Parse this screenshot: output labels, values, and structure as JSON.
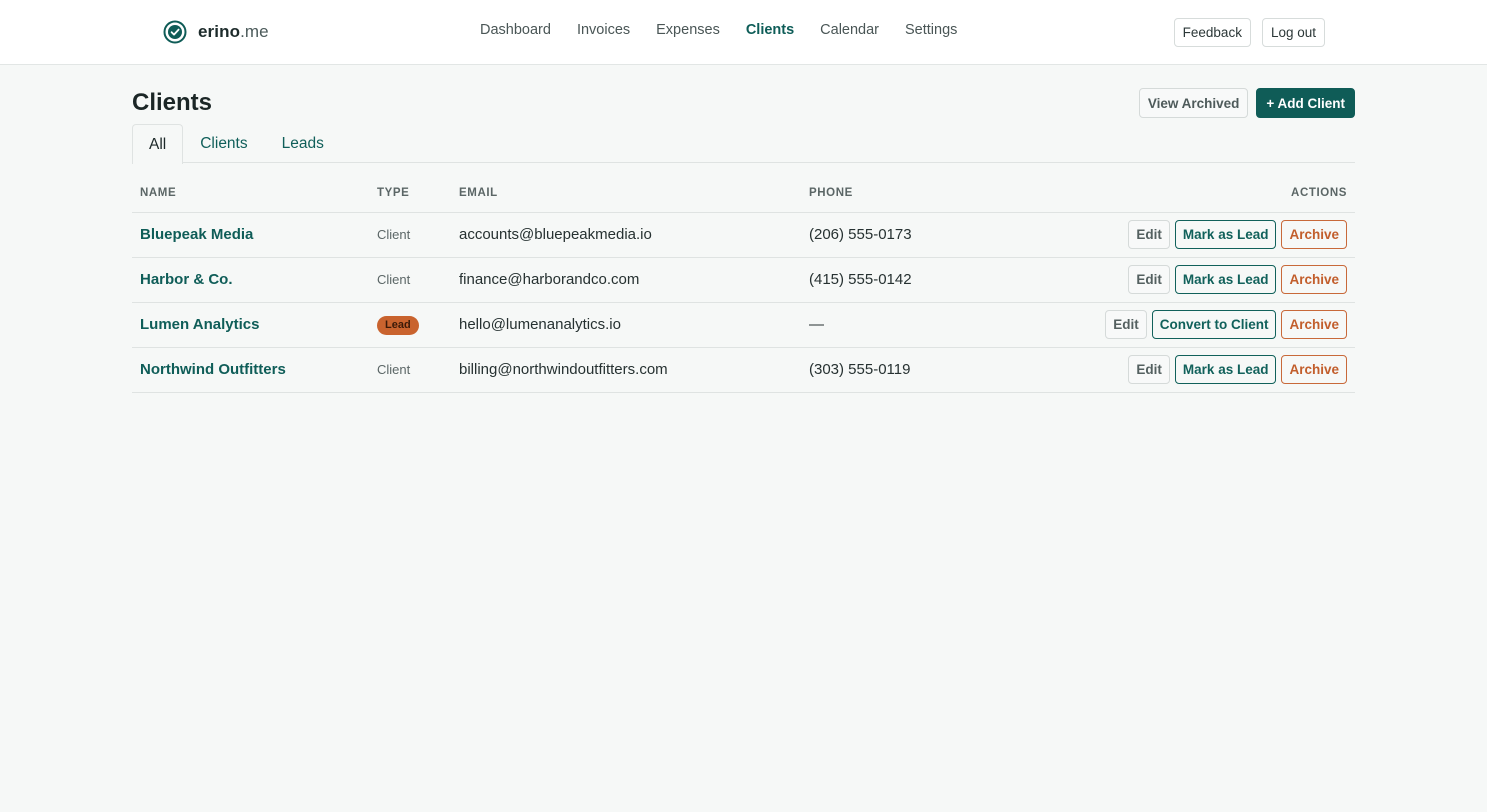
{
  "brand": {
    "name_main": "erino",
    "name_suffix": ".me",
    "logo_icon": "check-circle-icon"
  },
  "nav": {
    "items": [
      {
        "label": "Dashboard",
        "active": false
      },
      {
        "label": "Invoices",
        "active": false
      },
      {
        "label": "Expenses",
        "active": false
      },
      {
        "label": "Clients",
        "active": true
      },
      {
        "label": "Calendar",
        "active": false
      },
      {
        "label": "Settings",
        "active": false
      }
    ],
    "feedback_label": "Feedback",
    "logout_label": "Log out"
  },
  "page": {
    "title": "Clients",
    "view_archived_label": "View Archived",
    "add_client_label": "+ Add Client"
  },
  "tabs": [
    {
      "label": "All",
      "active": true
    },
    {
      "label": "Clients",
      "active": false
    },
    {
      "label": "Leads",
      "active": false
    }
  ],
  "table": {
    "headers": {
      "name": "NAME",
      "type": "TYPE",
      "email": "EMAIL",
      "phone": "PHONE",
      "actions": "ACTIONS"
    },
    "rows": [
      {
        "name": "Bluepeak Media",
        "type": "Client",
        "email": "accounts@bluepeakmedia.io",
        "phone": "(206) 555-0173",
        "edit": "Edit",
        "convert": "Mark as Lead",
        "archive": "Archive"
      },
      {
        "name": "Harbor & Co.",
        "type": "Client",
        "email": "finance@harborandco.com",
        "phone": "(415) 555-0142",
        "edit": "Edit",
        "convert": "Mark as Lead",
        "archive": "Archive"
      },
      {
        "name": "Lumen Analytics",
        "type": "Lead",
        "email": "hello@lumenanalytics.io",
        "phone": "—",
        "edit": "Edit",
        "convert": "Convert to Client",
        "archive": "Archive"
      },
      {
        "name": "Northwind Outfitters",
        "type": "Client",
        "email": "billing@northwindoutfitters.com",
        "phone": "(303) 555-0119",
        "edit": "Edit",
        "convert": "Mark as Lead",
        "archive": "Archive"
      }
    ]
  },
  "colors": {
    "accent": "#0f5c57",
    "lead_badge": "#c9632e",
    "archive": "#c25e2c",
    "background": "#f6f8f7"
  }
}
